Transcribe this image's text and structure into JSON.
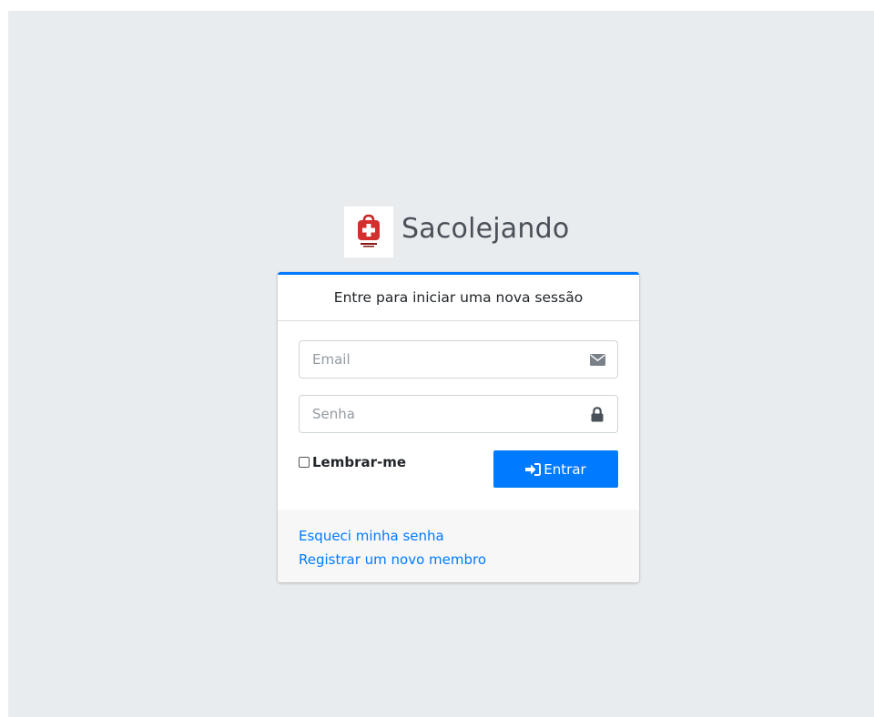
{
  "brand": {
    "name": "Sacolejando",
    "logo_color": "#d32f2f"
  },
  "login": {
    "message": "Entre para iniciar uma nova sessão",
    "email_placeholder": "Email",
    "password_placeholder": "Senha",
    "email_icon": "envelope-icon",
    "password_icon": "lock-icon",
    "remember_label": "Lembrar-me",
    "submit_label": "Entrar",
    "submit_icon": "sign-in-icon",
    "accent_color": "#007bff"
  },
  "footer": {
    "forgot_password": "Esqueci minha senha",
    "register": "Registrar um novo membro"
  }
}
